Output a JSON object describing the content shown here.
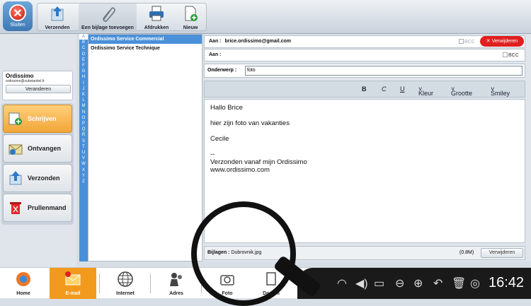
{
  "toolbar": {
    "close_label": "Sluiten",
    "buttons": [
      {
        "label": "Verzenden",
        "icon": "send-icon"
      },
      {
        "label": "Een bijlage toevoegen",
        "icon": "paperclip-icon"
      },
      {
        "label": "Afdrukken",
        "icon": "printer-icon"
      },
      {
        "label": "Nieuw",
        "icon": "new-document-icon"
      }
    ]
  },
  "account": {
    "name": "Ordissimo",
    "email": "ordissimo@substantiel.fr",
    "change_label": "Veranderen"
  },
  "side_nav": [
    {
      "label": "Schrijven",
      "icon": "write-icon",
      "active": true
    },
    {
      "label": "Ontvangen",
      "icon": "inbox-icon"
    },
    {
      "label": "Verzonden",
      "icon": "sent-icon"
    },
    {
      "label": "Prullenmand",
      "icon": "trash-icon"
    }
  ],
  "alphabet": [
    "A",
    "B",
    "C",
    "D",
    "E",
    "F",
    "G",
    "H",
    "I",
    "J",
    "K",
    "L",
    "M",
    "N",
    "O",
    "P",
    "Q",
    "R",
    "S",
    "T",
    "U",
    "V",
    "W",
    "X",
    "Y",
    "Z"
  ],
  "contacts": [
    {
      "name": "Ordissimo Service Commercial",
      "selected": true
    },
    {
      "name": "Ordissimo Service Technique",
      "selected": false
    }
  ],
  "compose": {
    "to_label": "Aan :",
    "to_value": "brice.ordissimo@gmail.com",
    "cc_label": "Aan :",
    "bcc_label": "BCC",
    "remove_label": "Verwijderen",
    "subject_label": "Onderwerp :",
    "subject_value": "foto",
    "format": {
      "bold": "B",
      "italic": "C",
      "underline": "U",
      "color": "Kleur",
      "size": "Grootte",
      "smiley": "Smiley"
    },
    "body": {
      "greeting": "Hallo Brice",
      "line1": "hier zijn foto van vakanties",
      "sign": "Cecile",
      "dash": "--",
      "footer1": "Verzonden vanaf mijn Ordissimo",
      "footer2": "www.ordissimo.com"
    },
    "attachments_label": "Bijlagen :",
    "attachment_file": "Dubrovnik.jpg",
    "attachment_size": "(0.8M)",
    "attachment_remove": "Verwijderen"
  },
  "taskbar": {
    "items": [
      {
        "label": "Home",
        "icon": "home-icon"
      },
      {
        "label": "E-mail",
        "icon": "email-icon",
        "active": true
      },
      {
        "label": "Internet",
        "icon": "globe-icon"
      },
      {
        "label": "Adres",
        "icon": "contacts-icon"
      },
      {
        "label": "Foto",
        "icon": "camera-icon"
      },
      {
        "label": "Docum",
        "icon": "document-icon"
      }
    ],
    "clock": "16:42"
  },
  "colors": {
    "accent": "#4a90d9",
    "active_orange": "#f29a1e",
    "delete_red": "#e02020"
  }
}
